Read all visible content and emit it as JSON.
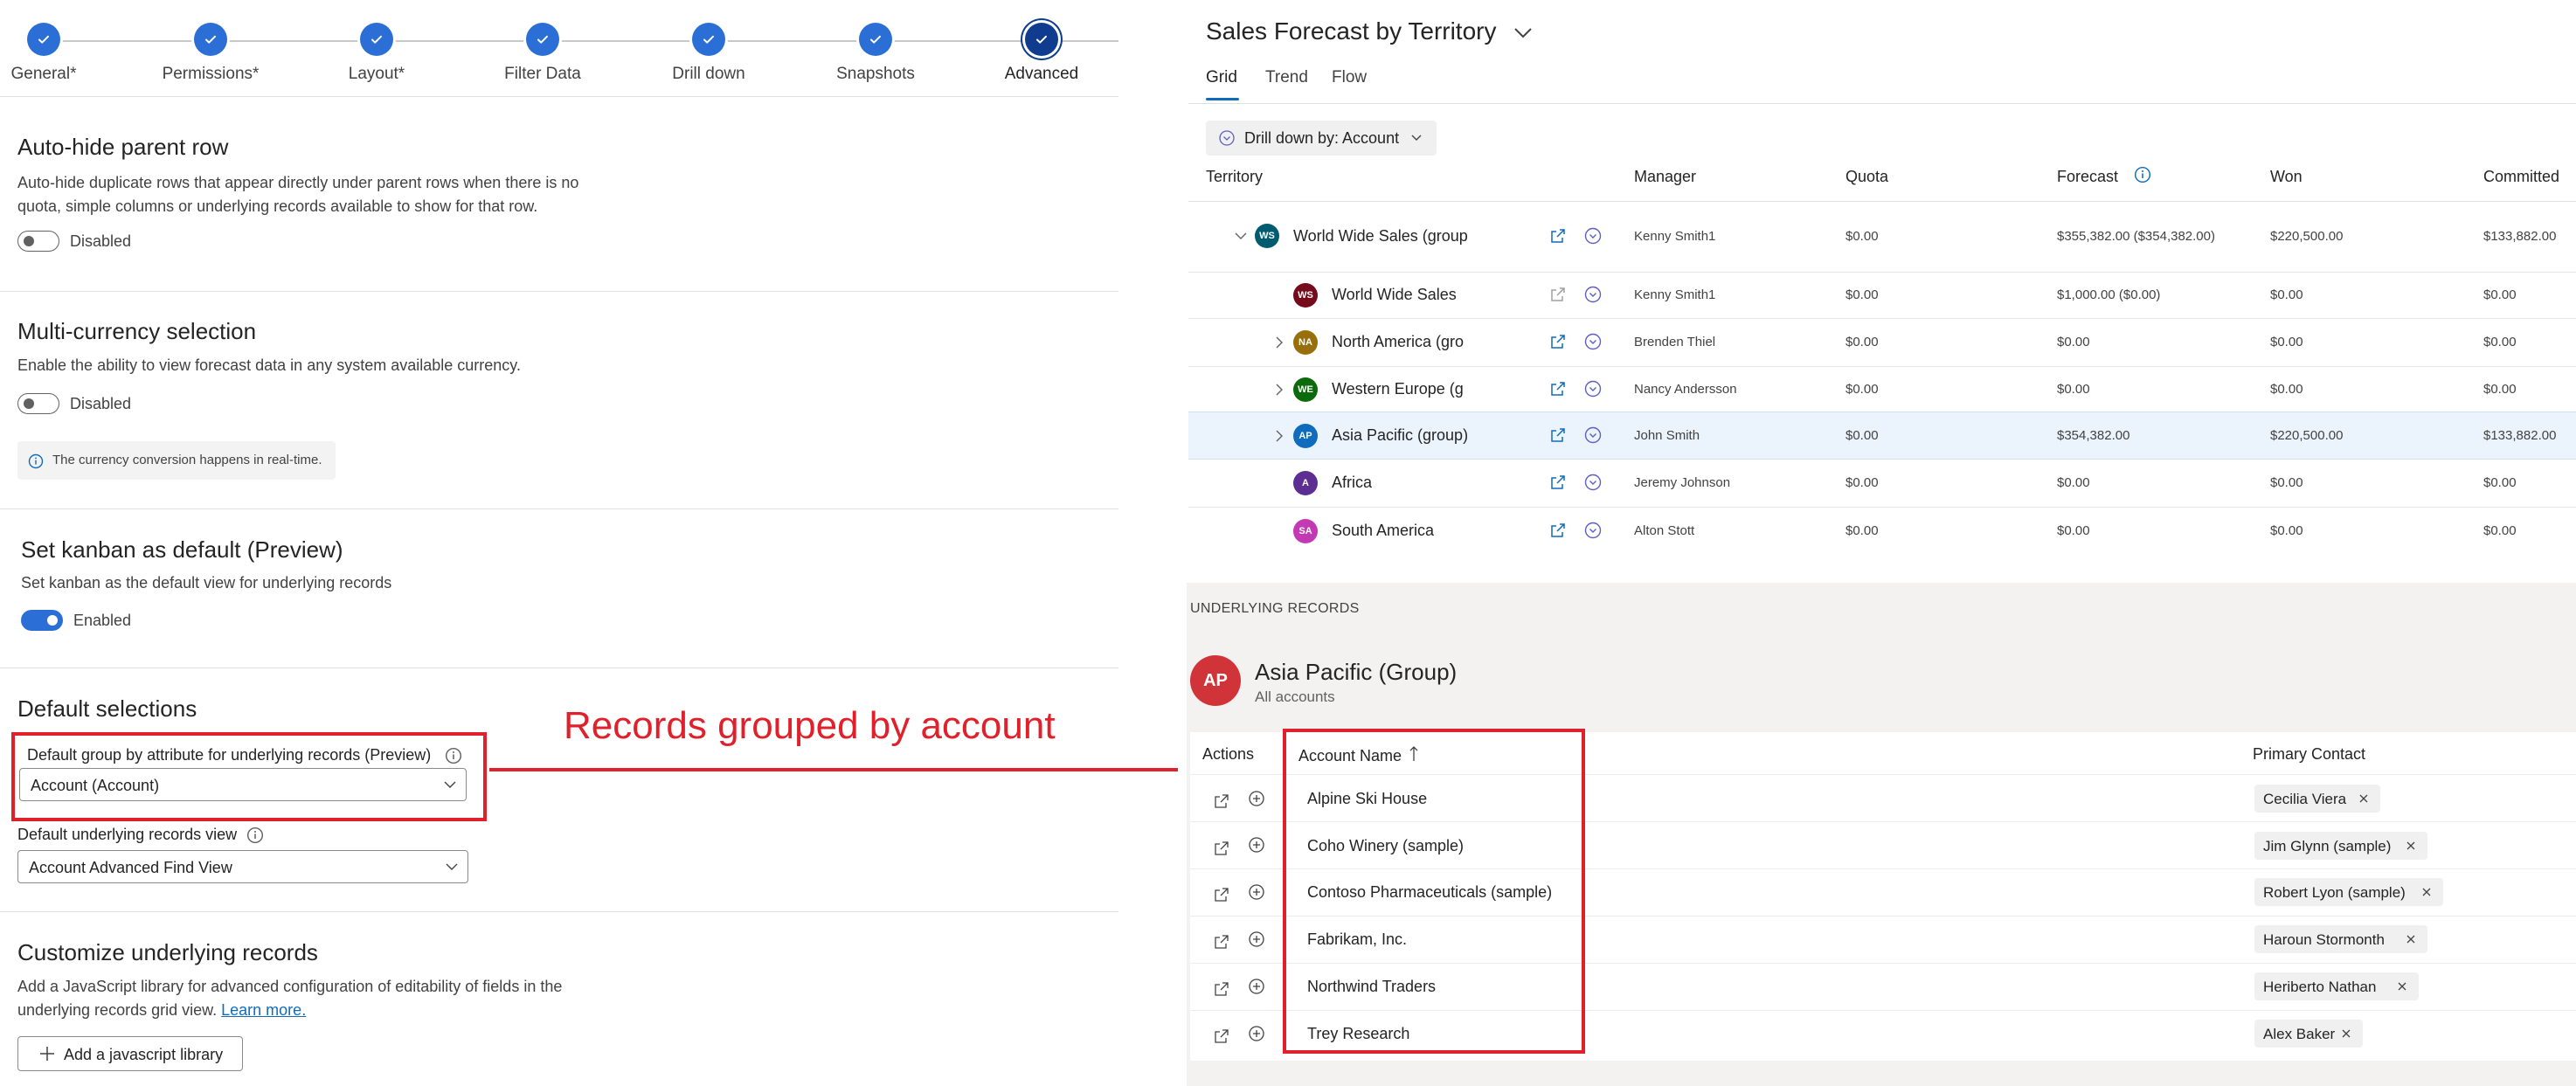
{
  "stepper": {
    "steps": [
      {
        "label": "General*"
      },
      {
        "label": "Permissions*"
      },
      {
        "label": "Layout*"
      },
      {
        "label": "Filter Data"
      },
      {
        "label": "Drill down"
      },
      {
        "label": "Snapshots"
      },
      {
        "label": "Advanced",
        "active": true
      }
    ]
  },
  "settings": {
    "auto_hide": {
      "title": "Auto-hide parent row",
      "desc_line1": "Auto-hide duplicate rows that appear directly under parent rows when there is no",
      "desc_line2": "quota, simple columns or underlying records available to show for that row.",
      "toggle_label": "Disabled",
      "enabled": false
    },
    "multi_currency": {
      "title": "Multi-currency selection",
      "desc": "Enable the ability to view forecast data in any system available currency.",
      "toggle_label": "Disabled",
      "enabled": false,
      "info": "The currency conversion happens in real-time."
    },
    "kanban": {
      "title": "Set kanban as default (Preview)",
      "desc": "Set kanban as the default view for underlying records",
      "toggle_label": "Enabled",
      "enabled": true
    },
    "default_selections": {
      "title": "Default selections",
      "group_by_label": "Default group by attribute for underlying records (Preview)",
      "group_by_value": "Account (Account)",
      "view_label": "Default underlying records view",
      "view_value": "Account Advanced Find View"
    },
    "customize": {
      "title": "Customize underlying records",
      "desc_line1": "Add a JavaScript library for advanced configuration of editability of fields in the",
      "desc_line2": "underlying records grid view.",
      "learn_more": "Learn more.",
      "add_button": "Add a javascript library"
    }
  },
  "annotation": {
    "text": "Records grouped by account",
    "color": "#e0202a"
  },
  "forecast": {
    "title": "Sales Forecast by Territory",
    "tabs": [
      {
        "label": "Grid",
        "active": true
      },
      {
        "label": "Trend"
      },
      {
        "label": "Flow"
      }
    ],
    "drill_label": "Drill down by: Account",
    "columns": {
      "territory": "Territory",
      "manager": "Manager",
      "quota": "Quota",
      "forecast": "Forecast",
      "won": "Won",
      "committed": "Committed"
    },
    "rows": [
      {
        "initials": "WS",
        "color": "#005b70",
        "name": "World Wide Sales (group)",
        "manager": "Kenny Smith1",
        "quota": "$0.00",
        "forecast": "$355,382.00 ($354,382.00)",
        "won": "$220,500.00",
        "committed": "$133,882.00",
        "caret": "down"
      },
      {
        "initials": "WS",
        "color": "#750b1c",
        "name": "World Wide Sales",
        "manager": "Kenny Smith1",
        "quota": "$0.00",
        "forecast": "$1,000.00 ($0.00)",
        "won": "$0.00",
        "committed": "$0.00"
      },
      {
        "initials": "NA",
        "color": "#986f0b",
        "name": "North America (group)",
        "manager": "Brenden Thiel",
        "quota": "$0.00",
        "forecast": "$0.00",
        "won": "$0.00",
        "committed": "$0.00",
        "caret": "right"
      },
      {
        "initials": "WE",
        "color": "#0b6a0b",
        "name": "Western Europe (group)",
        "manager": "Nancy Andersson",
        "quota": "$0.00",
        "forecast": "$0.00",
        "won": "$0.00",
        "committed": "$0.00",
        "caret": "right"
      },
      {
        "initials": "AP",
        "color": "#0f6cbd",
        "name": "Asia Pacific (group)",
        "manager": "John Smith",
        "quota": "$0.00",
        "forecast": "$354,382.00",
        "won": "$220,500.00",
        "committed": "$133,882.00",
        "caret": "right",
        "highlight": true
      },
      {
        "initials": "A",
        "color": "#5c2e91",
        "name": "Africa",
        "manager": "Jeremy Johnson",
        "quota": "$0.00",
        "forecast": "$0.00",
        "won": "$0.00",
        "committed": "$0.00"
      },
      {
        "initials": "SA",
        "color": "#c239b3",
        "name": "South America",
        "manager": "Alton Stott",
        "quota": "$0.00",
        "forecast": "$0.00",
        "won": "$0.00",
        "committed": "$0.00"
      }
    ]
  },
  "underlying": {
    "label": "UNDERLYING RECORDS",
    "group_initials": "AP",
    "group_title": "Asia Pacific (Group)",
    "group_sub": "All accounts",
    "columns": {
      "actions": "Actions",
      "account": "Account Name",
      "contact": "Primary Contact"
    },
    "records": [
      {
        "account": "Alpine Ski House",
        "contact": "Cecilia Viera"
      },
      {
        "account": "Coho Winery (sample)",
        "contact": "Jim Glynn (sample)"
      },
      {
        "account": "Contoso Pharmaceuticals (sample)",
        "contact": "Robert Lyon (sample)"
      },
      {
        "account": "Fabrikam, Inc.",
        "contact": "Haroun Stormonth"
      },
      {
        "account": "Northwind Traders",
        "contact": "Heriberto Nathan"
      },
      {
        "account": "Trey Research",
        "contact": "Alex Baker"
      }
    ]
  }
}
